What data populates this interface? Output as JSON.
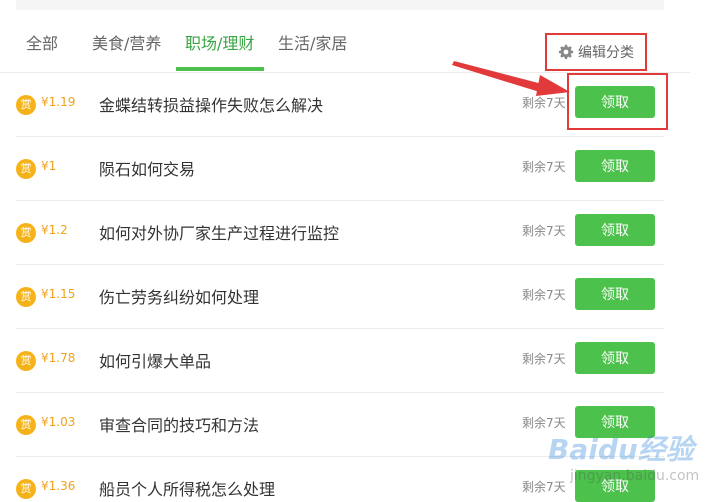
{
  "tabs": [
    {
      "label": "全部",
      "active": false
    },
    {
      "label": "美食/营养",
      "active": false
    },
    {
      "label": "职场/理财",
      "active": true
    },
    {
      "label": "生活/家居",
      "active": false
    }
  ],
  "edit_category": {
    "label": "编辑分类",
    "icon": "gear-icon"
  },
  "reward_badge_text": "赏",
  "tasks": [
    {
      "amount": "¥1.19",
      "title": "金蝶结转损益操作失败怎么解决",
      "remaining": "剩余7天",
      "action": "领取"
    },
    {
      "amount": "¥1",
      "title": "陨石如何交易",
      "remaining": "剩余7天",
      "action": "领取"
    },
    {
      "amount": "¥1.2",
      "title": "如何对外协厂家生产过程进行监控",
      "remaining": "剩余7天",
      "action": "领取"
    },
    {
      "amount": "¥1.15",
      "title": "伤亡劳务纠纷如何处理",
      "remaining": "剩余7天",
      "action": "领取"
    },
    {
      "amount": "¥1.78",
      "title": "如何引爆大单品",
      "remaining": "剩余7天",
      "action": "领取"
    },
    {
      "amount": "¥1.03",
      "title": "审查合同的技巧和方法",
      "remaining": "剩余7天",
      "action": "领取"
    },
    {
      "amount": "¥1.36",
      "title": "船员个人所得税怎么处理",
      "remaining": "剩余7天",
      "action": "领取"
    }
  ],
  "watermark": {
    "logo": "Baidu经验",
    "url": "jingyan.baidu.com"
  },
  "colors": {
    "accent_green": "#4cc24c",
    "highlight_red": "#e23a3a",
    "reward_orange": "#f0a21b"
  }
}
